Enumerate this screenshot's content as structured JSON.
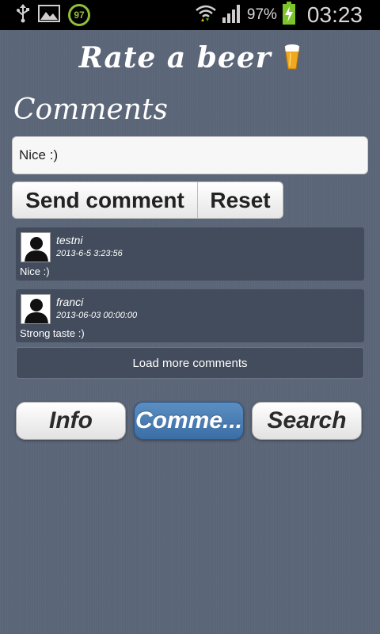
{
  "status_bar": {
    "notification_badge": "97",
    "battery_percent": "97%",
    "time": "03:23",
    "icons": [
      "usb-icon",
      "image-icon",
      "wifi-icon",
      "signal-icon",
      "battery-charging-icon"
    ]
  },
  "app": {
    "title": "Rate a beer",
    "title_icon": "beer-glass-icon"
  },
  "comments_section": {
    "heading": "Comments",
    "input_value": "Nice :)",
    "send_label": "Send comment",
    "reset_label": "Reset",
    "items": [
      {
        "user": "testni",
        "date": "2013-6-5 3:23:56",
        "text": "Nice :)"
      },
      {
        "user": "franci",
        "date": "2013-06-03 00:00:00",
        "text": "Strong taste :)"
      }
    ],
    "load_more_label": "Load more comments"
  },
  "bottom_nav": {
    "info_label": "Info",
    "comments_label": "Comme...",
    "search_label": "Search",
    "active": "comments"
  },
  "colors": {
    "background": "#5a6577",
    "comment_card": "#434c5c",
    "active_tab": "#4a7db3"
  }
}
